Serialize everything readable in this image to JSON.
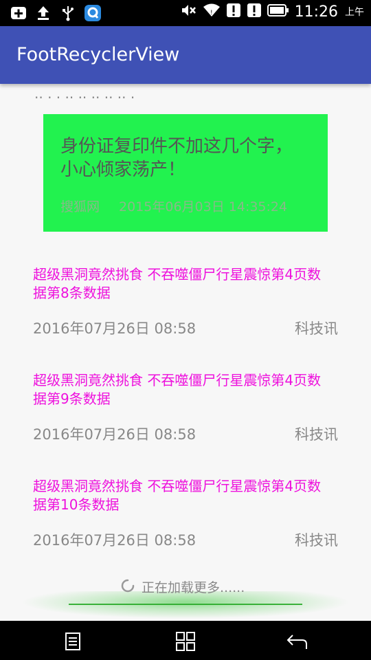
{
  "status_bar": {
    "time": "11:26",
    "ampm": "上午",
    "left_icons": [
      "add-box-icon",
      "upload-icon",
      "usb-icon",
      "app-q-icon"
    ],
    "right_icons": [
      "mute-icon",
      "wifi-icon",
      "alert-icon",
      "alert-icon",
      "battery-icon"
    ]
  },
  "app_bar": {
    "title": "FootRecyclerView"
  },
  "list": {
    "cut_text": "·· · · ·· ·· ·· ·· ·· ·",
    "featured": {
      "title": "身份证复印件不加这几个字，小心倾家荡产！",
      "source": "搜狐网",
      "date": "2015年06月03日 14:35:24",
      "background": "#22f24f"
    },
    "items": [
      {
        "title": "超级黑洞竟然挑食 不吞噬僵尸行星震惊第4页数据第8条数据",
        "date": "2016年07月26日 08:58",
        "source": "科技讯"
      },
      {
        "title": "超级黑洞竟然挑食 不吞噬僵尸行星震惊第4页数据第9条数据",
        "date": "2016年07月26日 08:58",
        "source": "科技讯"
      },
      {
        "title": "超级黑洞竟然挑食 不吞噬僵尸行星震惊第4页数据第10条数据",
        "date": "2016年07月26日 08:58",
        "source": "科技讯"
      }
    ],
    "loading_text": "正在加载更多......"
  },
  "colors": {
    "app_bar": "#3f51b5",
    "item_title": "#ee11dd"
  },
  "nav_bar": {
    "buttons": [
      "menu-icon",
      "apps-icon",
      "back-icon"
    ]
  }
}
